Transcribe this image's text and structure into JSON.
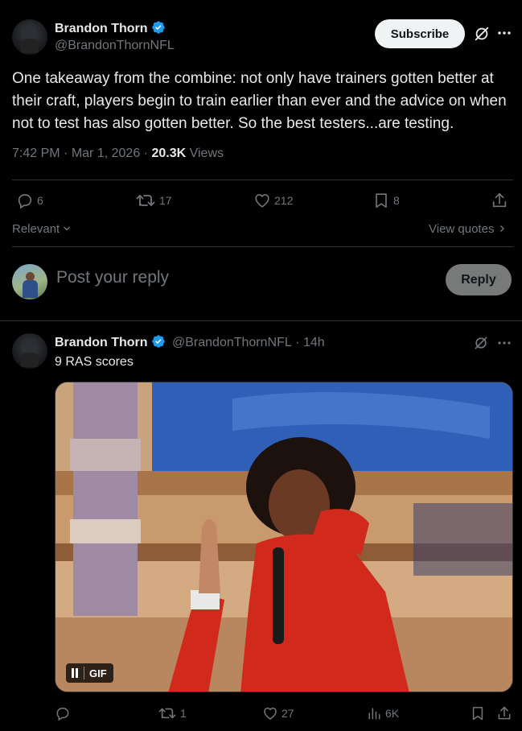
{
  "main_tweet": {
    "author_name": "Brandon Thorn",
    "author_handle": "@BrandonThornNFL",
    "subscribe_label": "Subscribe",
    "text": "One takeaway from the combine: not only have trainers gotten better at their craft, players begin to train earlier than ever and the advice on when not to test has also gotten better. So the best testers...are testing.",
    "time": "7:42 PM",
    "date": "Mar 1, 2026",
    "views_count": "20.3K",
    "views_label": "Views",
    "stats": {
      "replies": "6",
      "reposts": "17",
      "likes": "212",
      "bookmarks": "8"
    }
  },
  "sort": {
    "label": "Relevant",
    "view_quotes": "View quotes"
  },
  "composer": {
    "placeholder": "Post your reply",
    "reply_label": "Reply"
  },
  "reply_tweet": {
    "author_name": "Brandon Thorn",
    "author_handle": "@BrandonThornNFL",
    "separator": "·",
    "age": "14h",
    "text": "9 RAS scores",
    "media_badge": "GIF",
    "stats": {
      "replies": "",
      "reposts": "1",
      "likes": "27",
      "views": "6K"
    }
  },
  "colors": {
    "background": "#000000",
    "text": "#e7e9ea",
    "muted": "#71767b",
    "verified": "#1d9bf0",
    "divider": "#2f3336"
  }
}
